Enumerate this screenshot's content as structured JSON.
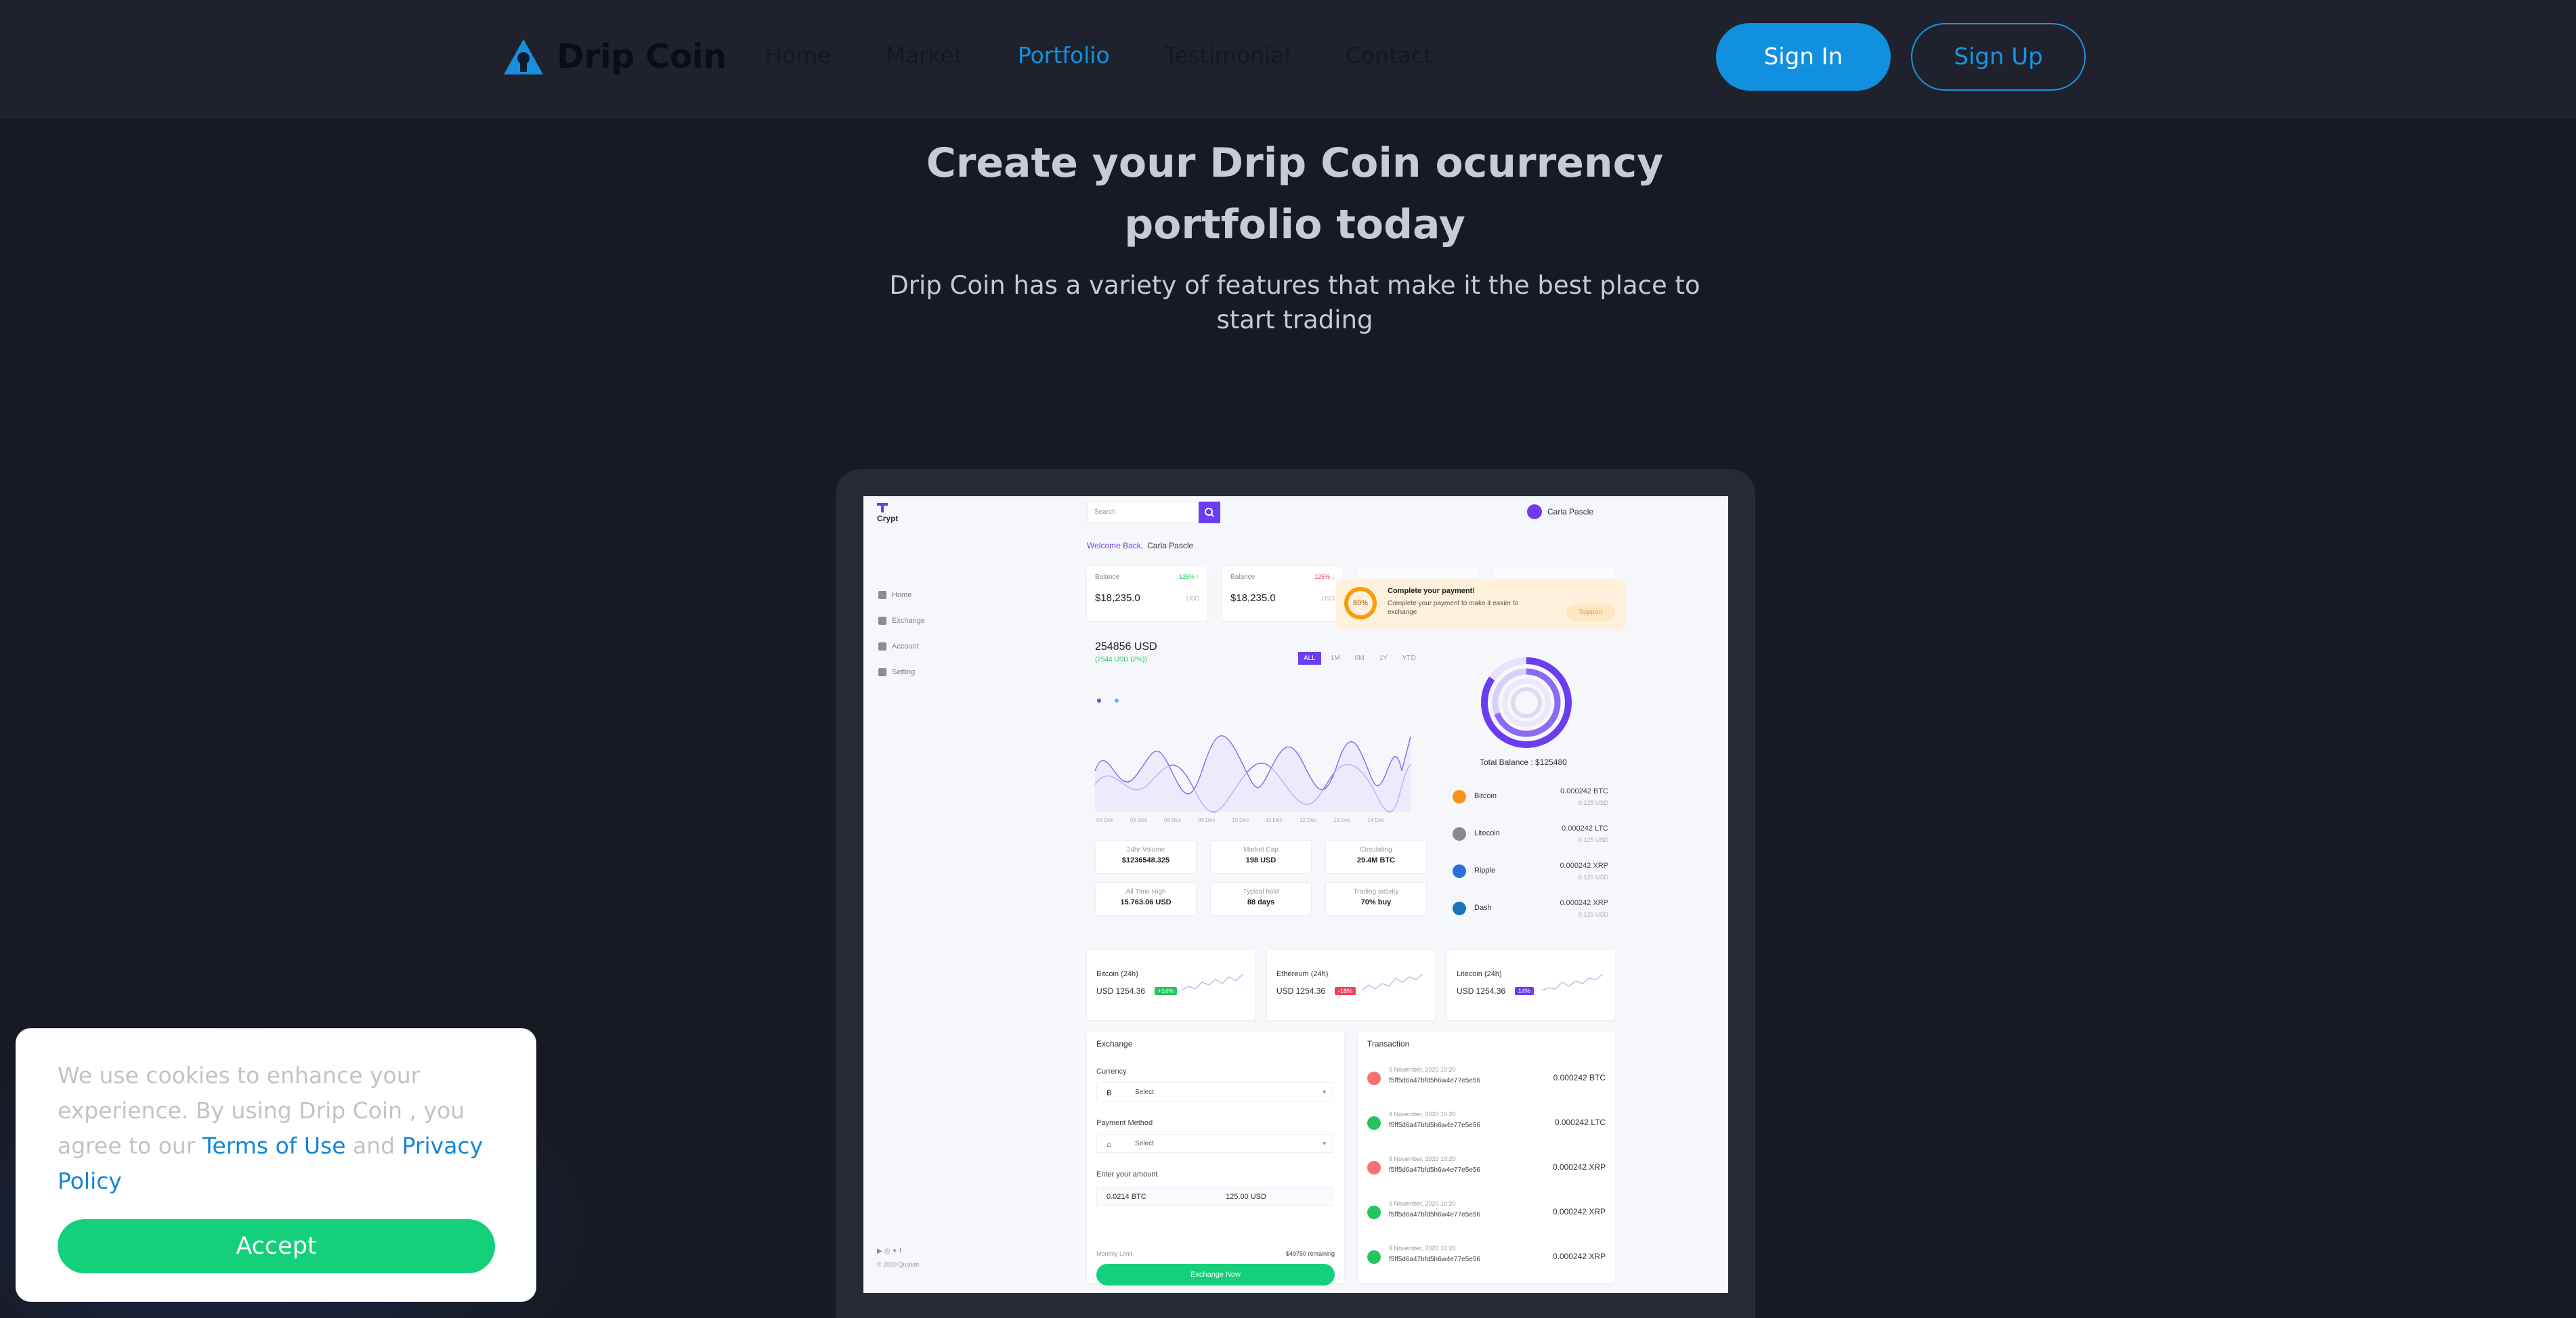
{
  "nav": {
    "brand": "Drip Coin",
    "links": [
      "Home",
      "Market",
      "Portfolio",
      "Testimonial",
      "Contact"
    ],
    "active_link": "Portfolio",
    "sign_in": "Sign In",
    "sign_up": "Sign Up"
  },
  "hero": {
    "title": "Create your Drip Coin ocurrency portfolio today",
    "subtitle": "Drip Coin has a variety of features that make it the best place to start trading"
  },
  "dashboard": {
    "brand": "Crypt",
    "menu": [
      "Home",
      "Exchange",
      "Account",
      "Setting"
    ],
    "search_placeholder": "Search",
    "user": "Carla Pascle",
    "welcome": "Welcome Back,",
    "welcome_name": "Carla Pascle",
    "balance_cards": [
      {
        "label": "Balance",
        "value": "$18,235.0",
        "unit": "USD",
        "pct": "125% ↑"
      },
      {
        "label": "Balance",
        "value": "$18,235.0",
        "unit": "USD",
        "pct": "125% ↓"
      }
    ],
    "payment_popup": {
      "percent": "80%",
      "title": "Complete your payment!",
      "text": "Complete your payment to make it easier to exchange",
      "button": "Support"
    },
    "chart_total": "254856 USD",
    "chart_change": "(2544 USD (2%))",
    "periods": [
      "ALL",
      "1M",
      "6M",
      "1Y",
      "YTD"
    ],
    "total_balance": "Total Balance : $125480",
    "coins": [
      {
        "name": "Bitcoin",
        "amount": "0.000242 BTC",
        "usd": "0.125 USD",
        "color": "#f7931a"
      },
      {
        "name": "Litecoin",
        "amount": "0.000242 LTC",
        "usd": "0.125 USD",
        "color": "#8a8a8a"
      },
      {
        "name": "Ripple",
        "amount": "0.000242 XRP",
        "usd": "0.125 USD",
        "color": "#2a6fdb"
      },
      {
        "name": "Dash",
        "amount": "0.000242 XRP",
        "usd": "0.125 USD",
        "color": "#1c75bc"
      }
    ],
    "stats": [
      {
        "label": "24hr Volume",
        "value": "$1236548.325"
      },
      {
        "label": "Market Cap",
        "value": "198 USD"
      },
      {
        "label": "Circulating",
        "value": "29.4M BTC"
      },
      {
        "label": "All Time High",
        "value": "15.763.06 USD"
      },
      {
        "label": "Typical hold",
        "value": "88 days"
      },
      {
        "label": "Trading activity",
        "value": "70% buy"
      }
    ],
    "minis": [
      {
        "name": "Bitcoin (24h)",
        "value": "USD 1254.36",
        "badge": "+14%",
        "badge_color": "#22c55e"
      },
      {
        "name": "Ethereum (24h)",
        "value": "USD 1254.36",
        "badge": "-18%",
        "badge_color": "#f43f5e"
      },
      {
        "name": "Litecoin (24h)",
        "value": "USD 1254.36",
        "badge": "14%",
        "badge_color": "#6b3cf0"
      }
    ],
    "exchange": {
      "title": "Exchange",
      "currency_label": "Currency",
      "payment_label": "Payment Method",
      "select": "Select",
      "amount_label": "Enter your amount",
      "amount_btc": "0.0214 BTC",
      "amount_usd": "125.00 USD",
      "limit_label": "Monthly Limit",
      "limit_value": "$49750 remaining",
      "button": "Exchange Now"
    },
    "transactions": {
      "title": "Transaction",
      "rows": [
        {
          "date": "9 November, 2020 10:20",
          "hash": "f5ff5d6a47bfd5h6w4e77e5e56",
          "amount": "0.000242 BTC",
          "color": "#f87171"
        },
        {
          "date": "9 November, 2020 10:20",
          "hash": "f5ff5d6a47bfd5h6w4e77e5e56",
          "amount": "0.000242 LTC",
          "color": "#22c55e"
        },
        {
          "date": "9 November, 2020 10:20",
          "hash": "f5ff5d6a47bfd5h6w4e77e5e56",
          "amount": "0.000242 XRP",
          "color": "#f87171"
        },
        {
          "date": "9 November, 2020 10:20",
          "hash": "f5ff5d6a47bfd5h6w4e77e5e56",
          "amount": "0.000242 XRP",
          "color": "#22c55e"
        },
        {
          "date": "9 November, 2020 10:20",
          "hash": "f5ff5d6a47bfd5h6w4e77e5e56",
          "amount": "0.000242 XRP",
          "color": "#22c55e"
        }
      ]
    },
    "copyright": "© 2020 Quixlab"
  },
  "cookie": {
    "text_before": "We use cookies to enhance your experience. By using Drip Coin , you agree to our",
    "terms": "Terms of Use",
    "and": "and",
    "privacy": "Privacy Policy",
    "accept": "Accept"
  },
  "colors": {
    "accent": "#1190e0",
    "accept_green": "#14d07b",
    "page_bg": "#171a22",
    "nav_bg": "#1f222d"
  }
}
